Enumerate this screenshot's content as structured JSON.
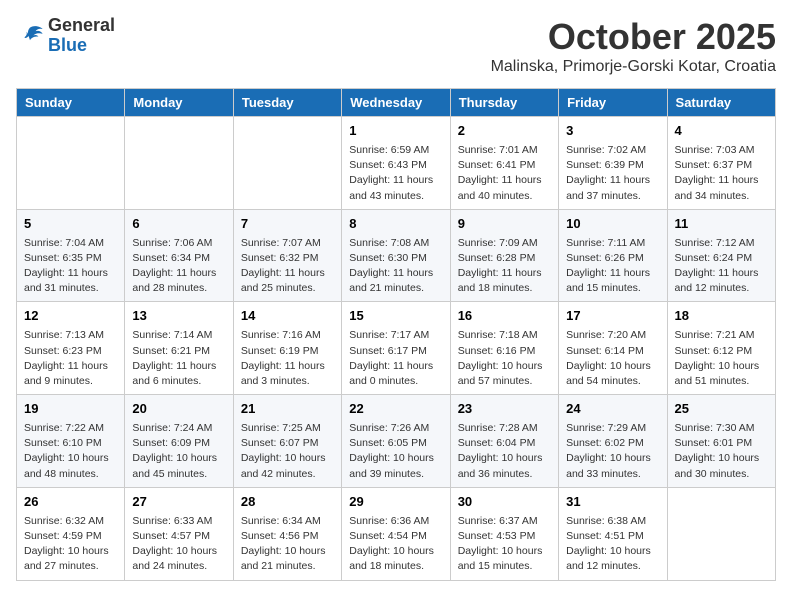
{
  "header": {
    "logo_general": "General",
    "logo_blue": "Blue",
    "month": "October 2025",
    "location": "Malinska, Primorje-Gorski Kotar, Croatia"
  },
  "weekdays": [
    "Sunday",
    "Monday",
    "Tuesday",
    "Wednesday",
    "Thursday",
    "Friday",
    "Saturday"
  ],
  "weeks": [
    [
      {
        "day": "",
        "info": ""
      },
      {
        "day": "",
        "info": ""
      },
      {
        "day": "",
        "info": ""
      },
      {
        "day": "1",
        "info": "Sunrise: 6:59 AM\nSunset: 6:43 PM\nDaylight: 11 hours\nand 43 minutes."
      },
      {
        "day": "2",
        "info": "Sunrise: 7:01 AM\nSunset: 6:41 PM\nDaylight: 11 hours\nand 40 minutes."
      },
      {
        "day": "3",
        "info": "Sunrise: 7:02 AM\nSunset: 6:39 PM\nDaylight: 11 hours\nand 37 minutes."
      },
      {
        "day": "4",
        "info": "Sunrise: 7:03 AM\nSunset: 6:37 PM\nDaylight: 11 hours\nand 34 minutes."
      }
    ],
    [
      {
        "day": "5",
        "info": "Sunrise: 7:04 AM\nSunset: 6:35 PM\nDaylight: 11 hours\nand 31 minutes."
      },
      {
        "day": "6",
        "info": "Sunrise: 7:06 AM\nSunset: 6:34 PM\nDaylight: 11 hours\nand 28 minutes."
      },
      {
        "day": "7",
        "info": "Sunrise: 7:07 AM\nSunset: 6:32 PM\nDaylight: 11 hours\nand 25 minutes."
      },
      {
        "day": "8",
        "info": "Sunrise: 7:08 AM\nSunset: 6:30 PM\nDaylight: 11 hours\nand 21 minutes."
      },
      {
        "day": "9",
        "info": "Sunrise: 7:09 AM\nSunset: 6:28 PM\nDaylight: 11 hours\nand 18 minutes."
      },
      {
        "day": "10",
        "info": "Sunrise: 7:11 AM\nSunset: 6:26 PM\nDaylight: 11 hours\nand 15 minutes."
      },
      {
        "day": "11",
        "info": "Sunrise: 7:12 AM\nSunset: 6:24 PM\nDaylight: 11 hours\nand 12 minutes."
      }
    ],
    [
      {
        "day": "12",
        "info": "Sunrise: 7:13 AM\nSunset: 6:23 PM\nDaylight: 11 hours\nand 9 minutes."
      },
      {
        "day": "13",
        "info": "Sunrise: 7:14 AM\nSunset: 6:21 PM\nDaylight: 11 hours\nand 6 minutes."
      },
      {
        "day": "14",
        "info": "Sunrise: 7:16 AM\nSunset: 6:19 PM\nDaylight: 11 hours\nand 3 minutes."
      },
      {
        "day": "15",
        "info": "Sunrise: 7:17 AM\nSunset: 6:17 PM\nDaylight: 11 hours\nand 0 minutes."
      },
      {
        "day": "16",
        "info": "Sunrise: 7:18 AM\nSunset: 6:16 PM\nDaylight: 10 hours\nand 57 minutes."
      },
      {
        "day": "17",
        "info": "Sunrise: 7:20 AM\nSunset: 6:14 PM\nDaylight: 10 hours\nand 54 minutes."
      },
      {
        "day": "18",
        "info": "Sunrise: 7:21 AM\nSunset: 6:12 PM\nDaylight: 10 hours\nand 51 minutes."
      }
    ],
    [
      {
        "day": "19",
        "info": "Sunrise: 7:22 AM\nSunset: 6:10 PM\nDaylight: 10 hours\nand 48 minutes."
      },
      {
        "day": "20",
        "info": "Sunrise: 7:24 AM\nSunset: 6:09 PM\nDaylight: 10 hours\nand 45 minutes."
      },
      {
        "day": "21",
        "info": "Sunrise: 7:25 AM\nSunset: 6:07 PM\nDaylight: 10 hours\nand 42 minutes."
      },
      {
        "day": "22",
        "info": "Sunrise: 7:26 AM\nSunset: 6:05 PM\nDaylight: 10 hours\nand 39 minutes."
      },
      {
        "day": "23",
        "info": "Sunrise: 7:28 AM\nSunset: 6:04 PM\nDaylight: 10 hours\nand 36 minutes."
      },
      {
        "day": "24",
        "info": "Sunrise: 7:29 AM\nSunset: 6:02 PM\nDaylight: 10 hours\nand 33 minutes."
      },
      {
        "day": "25",
        "info": "Sunrise: 7:30 AM\nSunset: 6:01 PM\nDaylight: 10 hours\nand 30 minutes."
      }
    ],
    [
      {
        "day": "26",
        "info": "Sunrise: 6:32 AM\nSunset: 4:59 PM\nDaylight: 10 hours\nand 27 minutes."
      },
      {
        "day": "27",
        "info": "Sunrise: 6:33 AM\nSunset: 4:57 PM\nDaylight: 10 hours\nand 24 minutes."
      },
      {
        "day": "28",
        "info": "Sunrise: 6:34 AM\nSunset: 4:56 PM\nDaylight: 10 hours\nand 21 minutes."
      },
      {
        "day": "29",
        "info": "Sunrise: 6:36 AM\nSunset: 4:54 PM\nDaylight: 10 hours\nand 18 minutes."
      },
      {
        "day": "30",
        "info": "Sunrise: 6:37 AM\nSunset: 4:53 PM\nDaylight: 10 hours\nand 15 minutes."
      },
      {
        "day": "31",
        "info": "Sunrise: 6:38 AM\nSunset: 4:51 PM\nDaylight: 10 hours\nand 12 minutes."
      },
      {
        "day": "",
        "info": ""
      }
    ]
  ]
}
